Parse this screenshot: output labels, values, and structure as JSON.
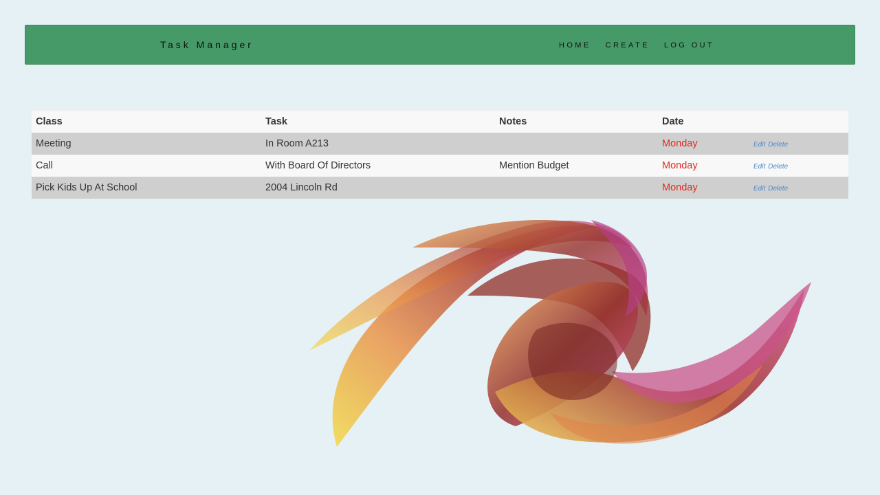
{
  "navbar": {
    "brand": "Task Manager",
    "links": [
      "HOME",
      "CREATE",
      "LOG OUT"
    ]
  },
  "table": {
    "headers": [
      "Class",
      "Task",
      "Notes",
      "Date"
    ],
    "rows": [
      {
        "class": "Meeting",
        "task": "In Room A213",
        "notes": "",
        "date": "Monday",
        "edit": "Edit",
        "delete": "Delete"
      },
      {
        "class": "Call",
        "task": "With Board Of Directors",
        "notes": "Mention Budget",
        "date": "Monday",
        "edit": "Edit",
        "delete": "Delete"
      },
      {
        "class": "Pick Kids Up At School",
        "task": "2004 Lincoln Rd",
        "notes": "",
        "date": "Monday",
        "edit": "Edit",
        "delete": "Delete"
      }
    ]
  },
  "colors": {
    "navbar": "#459a68",
    "background": "#e6f1f5",
    "date": "#e02b1f",
    "action_link": "#4a86c8"
  },
  "decor": {
    "image": "abstract-swirl-graphic"
  }
}
